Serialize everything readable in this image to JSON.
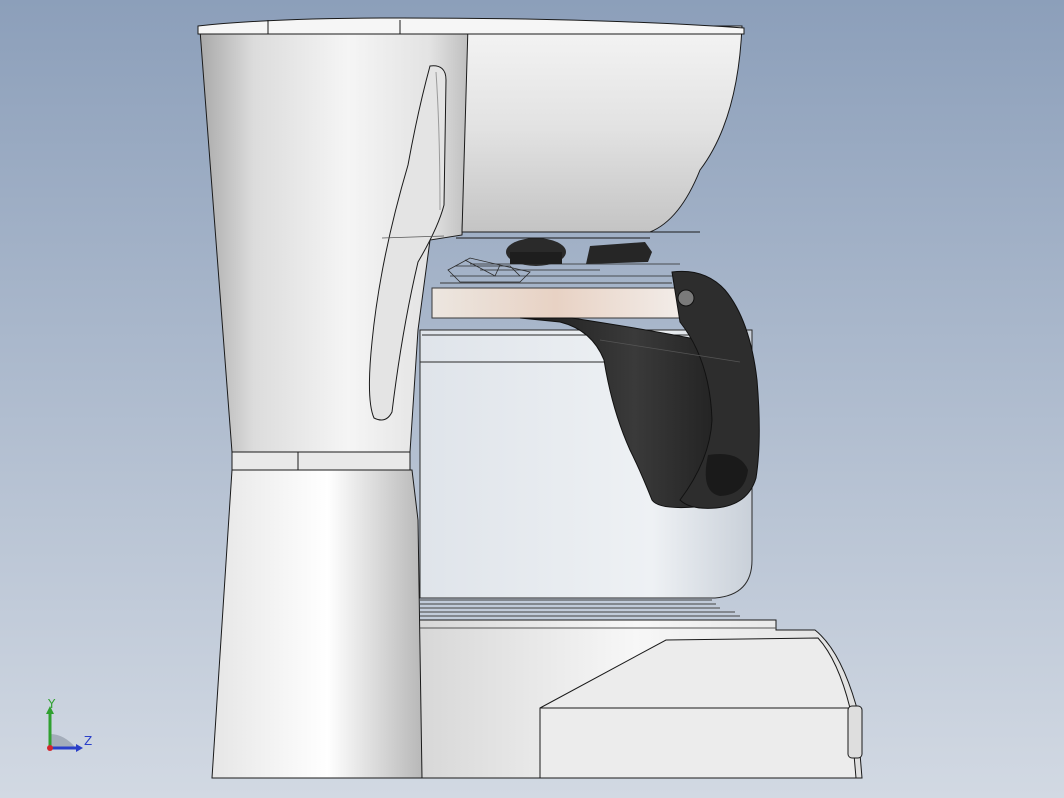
{
  "app": {
    "title": "",
    "view": "Right"
  },
  "colors": {
    "bg_top": "#8fa2bc",
    "bg_bottom": "#d0d7e1",
    "body_light": "#f2f2f2",
    "body_mid": "#d9d9d9",
    "body_dark": "#b6b6b6",
    "edge": "#1a1a1a",
    "handle": "#2b2b2b",
    "band": "#e9d8cc",
    "axis_x": "#d4262e",
    "axis_y": "#2fa02f",
    "axis_z": "#2a3fc9"
  },
  "triad": {
    "y_label": "Y",
    "z_label": "Z"
  }
}
